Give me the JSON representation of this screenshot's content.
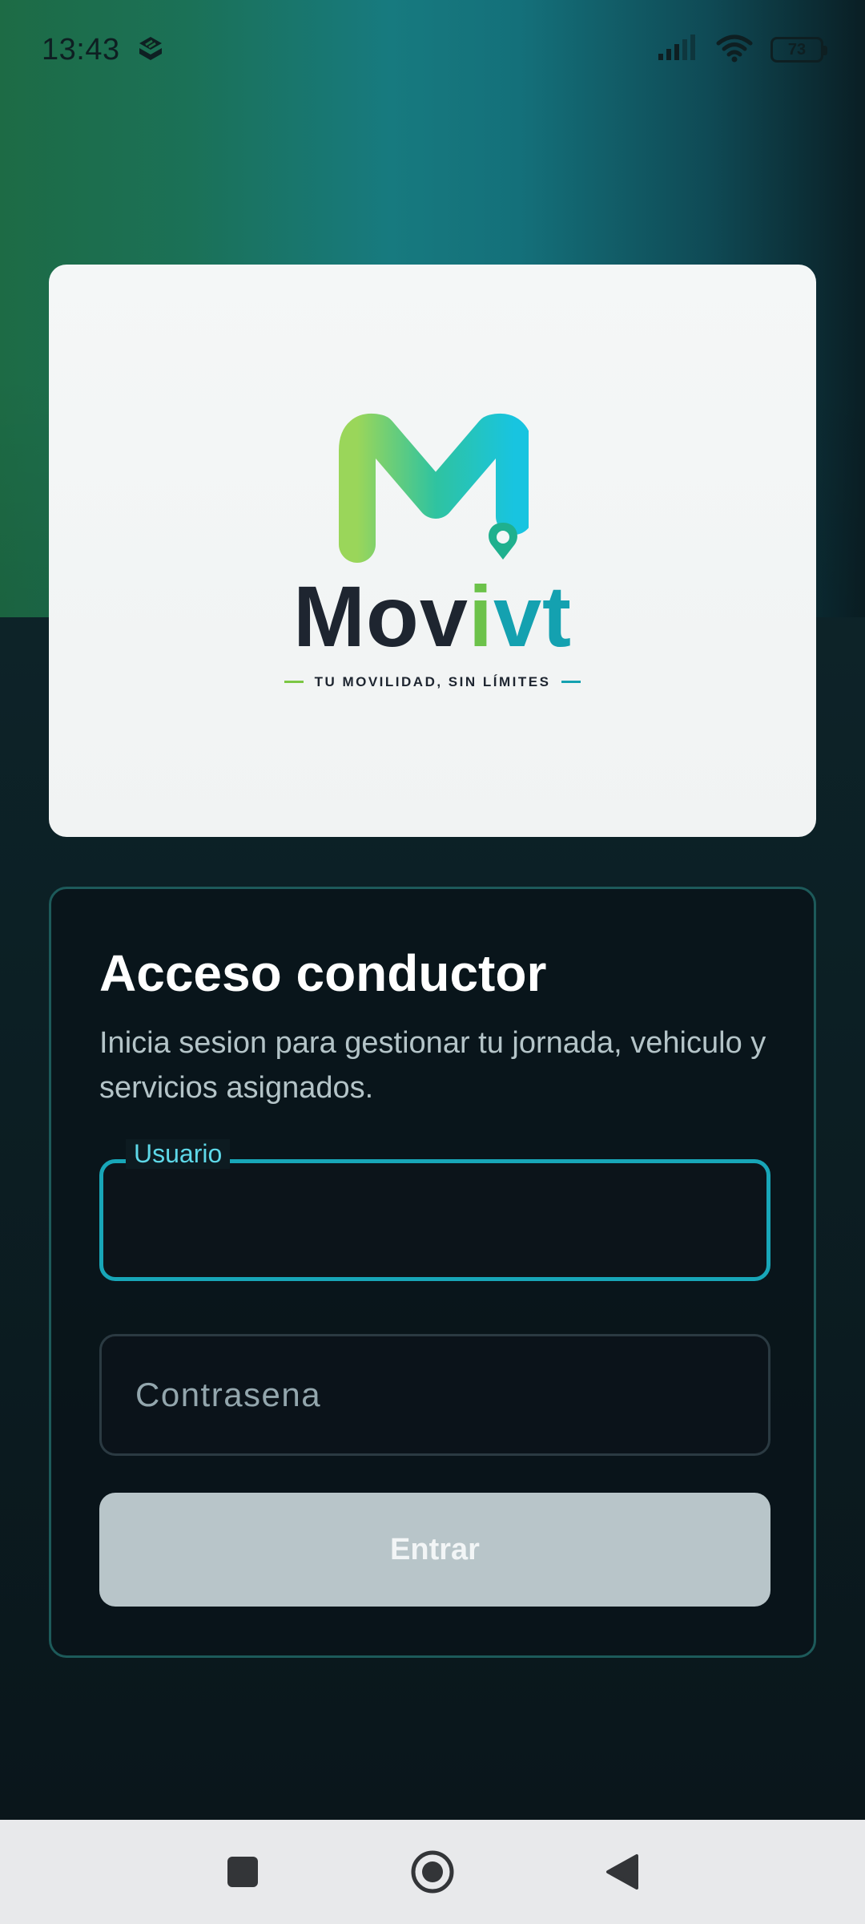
{
  "status_bar": {
    "time": "13:43",
    "battery": "73",
    "icons": [
      "notification-app-icon",
      "signal-icon",
      "wifi-icon",
      "battery-icon"
    ]
  },
  "logo": {
    "wordmark_part1": "Mov",
    "wordmark_part2": "i",
    "wordmark_part3": "vt",
    "tagline": "TU MOVILIDAD, SIN LÍMITES"
  },
  "login": {
    "title": "Acceso conductor",
    "subtitle": "Inicia sesion para gestionar tu jornada, vehiculo y servicios asignados.",
    "username_label": "Usuario",
    "username_value": "",
    "password_placeholder": "Contrasena",
    "submit_label": "Entrar"
  },
  "colors": {
    "accent": "#18a6b8",
    "brand_green": "#6cc24a",
    "brand_teal": "#14a1b0",
    "button_disabled": "#b8c5c9"
  },
  "nav_bar": {
    "icons": [
      "recents-square-icon",
      "home-circle-icon",
      "back-triangle-icon"
    ]
  }
}
